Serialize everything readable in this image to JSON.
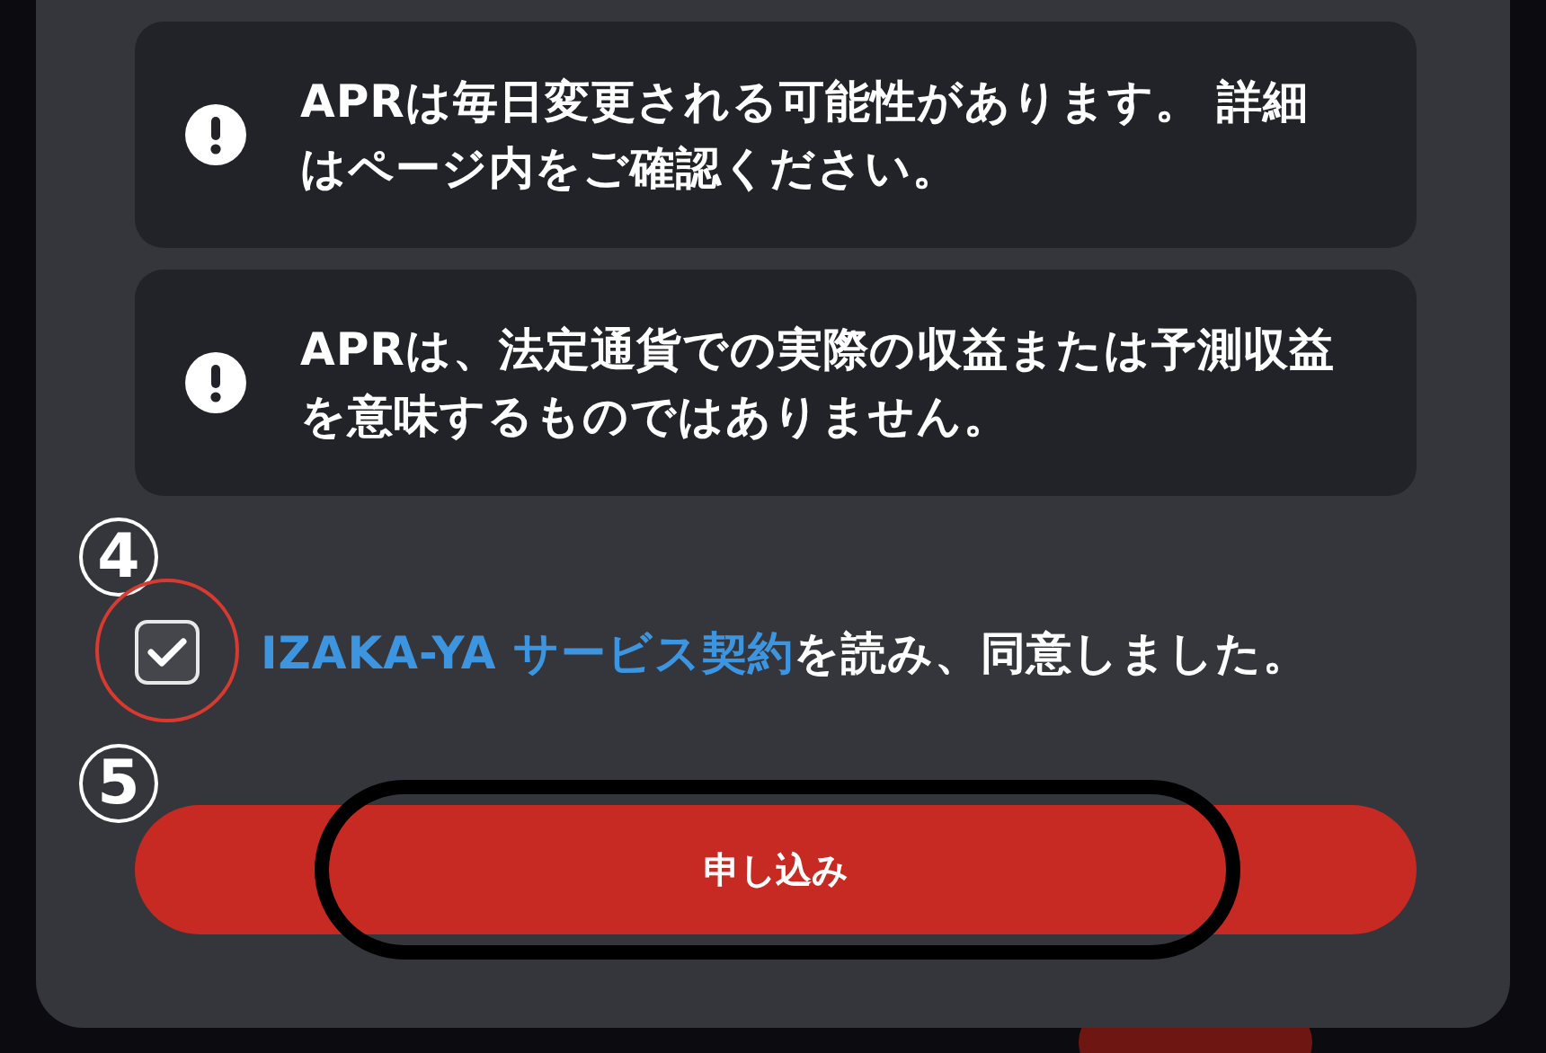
{
  "notices": [
    {
      "text": "APRは毎日変更される可能性があります。 詳細はページ内をご確認ください。"
    },
    {
      "text": "APRは、法定通貨での実際の収益または予測収益を意味するものではありません。"
    }
  ],
  "agreement": {
    "checked": true,
    "highlighted": true,
    "marker": "4",
    "link": "IZAKA-YA サービス契約",
    "text": "を読み、同意しました。"
  },
  "submit_button": {
    "label": "申し込み",
    "highlighted": true,
    "marker": "5"
  }
}
